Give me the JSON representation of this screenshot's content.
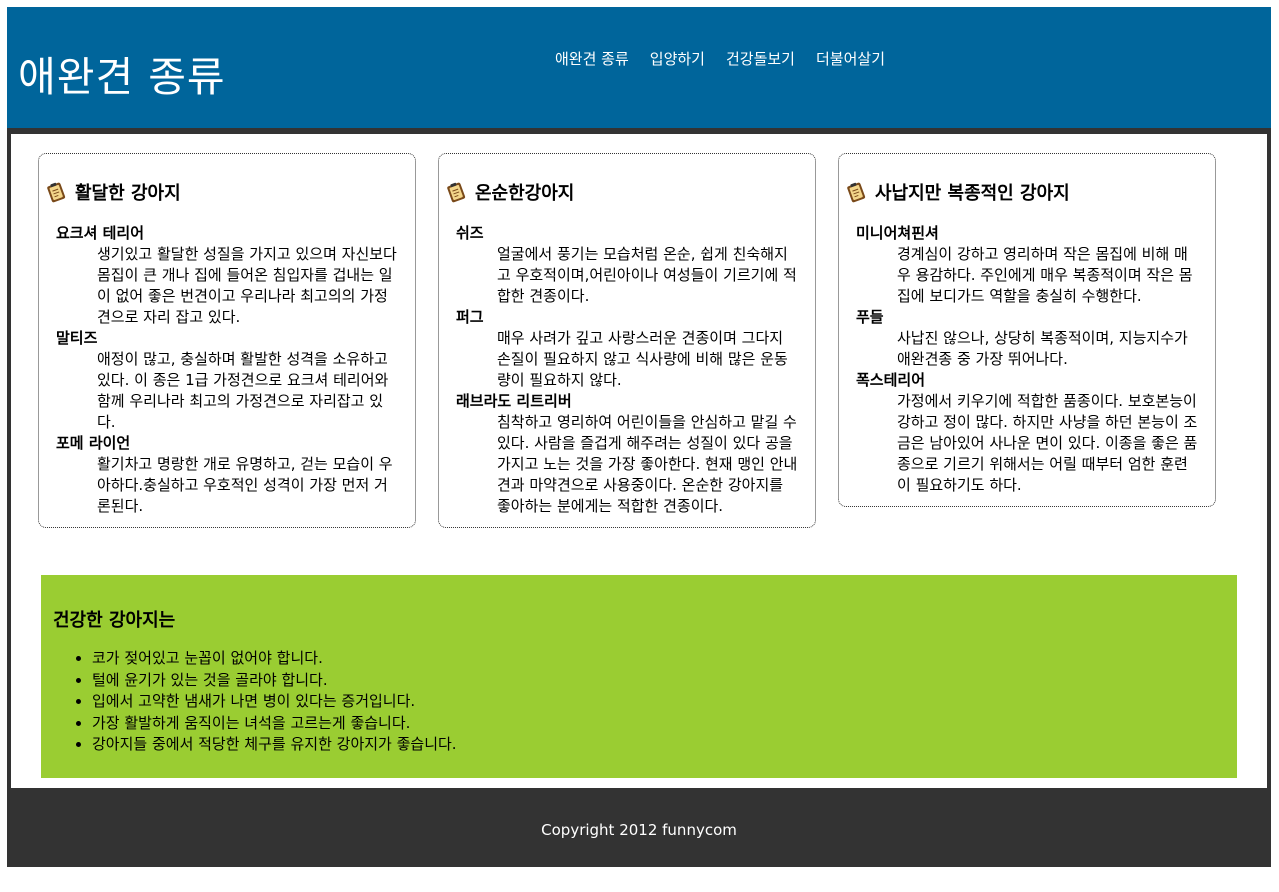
{
  "header": {
    "title": "애완견 종류",
    "nav": [
      "애완견 종류",
      "입양하기",
      "건강돌보기",
      "더불어살기"
    ]
  },
  "cards": [
    {
      "title": "활달한 강아지",
      "items": [
        {
          "name": "요크셔 테리어",
          "desc": "생기있고 활달한 성질을 가지고 있으며 자신보다 몸집이 큰 개나 집에 들어온 침입자를 겁내는 일이 없어 좋은 번견이고 우리나라 최고의의 가정견으로 자리 잡고 있다."
        },
        {
          "name": "말티즈",
          "desc": "애정이 많고, 충실하며 활발한 성격을 소유하고있다. 이 종은 1급 가정견으로 요크셔 테리어와 함께 우리나라 최고의 가정견으로 자리잡고 있다."
        },
        {
          "name": "포메 라이언",
          "desc": "활기차고 명랑한 개로 유명하고, 걷는 모습이 우아하다.충실하고 우호적인 성격이 가장 먼저 거론된다."
        }
      ]
    },
    {
      "title": "온순한강아지",
      "items": [
        {
          "name": "쉬즈",
          "desc": "얼굴에서 풍기는 모습처럼 온순, 쉽게 친숙해지고 우호적이며,어린아이나 여성들이 기르기에 적합한 견종이다."
        },
        {
          "name": "퍼그",
          "desc": "매우 사려가 깊고 사랑스러운 견종이며 그다지 손질이 필요하지 않고 식사량에 비해 많은 운동량이 필요하지 않다."
        },
        {
          "name": "래브라도 리트리버",
          "desc": "침착하고 영리하여 어린이들을 안심하고 맡길 수 있다. 사람을 즐겁게 해주려는 성질이 있다 공을 가지고 노는 것을 가장 좋아한다. 현재 맹인 안내견과 마약견으로 사용중이다. 온순한 강아지를 좋아하는 분에게는 적합한 견종이다."
        }
      ]
    },
    {
      "title": "사납지만 복종적인 강아지",
      "items": [
        {
          "name": "미니어쳐핀셔",
          "desc": "경계심이 강하고 영리하며 작은 몸집에 비해 매우 용감하다. 주인에게 매우 복종적이며 작은 몸집에 보디가드 역할을 충실히 수행한다."
        },
        {
          "name": "푸들",
          "desc": "사납진 않으나, 상당히 복종적이며, 지능지수가 애완견종 중 가장 뛰어나다."
        },
        {
          "name": "폭스테리어",
          "desc": "가정에서 키우기에 적합한 품종이다. 보호본능이 강하고 정이 많다. 하지만 사냥을 하던 본능이 조금은 남아있어 사나운 면이 있다. 이종을 좋은 품종으로 기르기 위해서는 어릴 때부터 엄한 훈련이 필요하기도 하다."
        }
      ]
    }
  ],
  "health": {
    "title": "건강한 강아지는",
    "items": [
      "코가 젖어있고 눈꼽이 없어야 합니다.",
      "털에 윤기가 있는 것을 골라야 합니다.",
      "입에서 고약한 냄새가 나면 병이 있다는 증거입니다.",
      "가장 활발하게 움직이는 녀석을 고르는게 좋습니다.",
      "강아지들 중에서 적당한 체구를 유지한 강아지가 좋습니다."
    ]
  },
  "footer": {
    "text": "Copyright 2012 funnycom"
  },
  "colors": {
    "header": "#00659b",
    "frame": "#333333",
    "health_bg": "#9acd32"
  },
  "icons": {
    "card_icon": "notepad-icon"
  }
}
